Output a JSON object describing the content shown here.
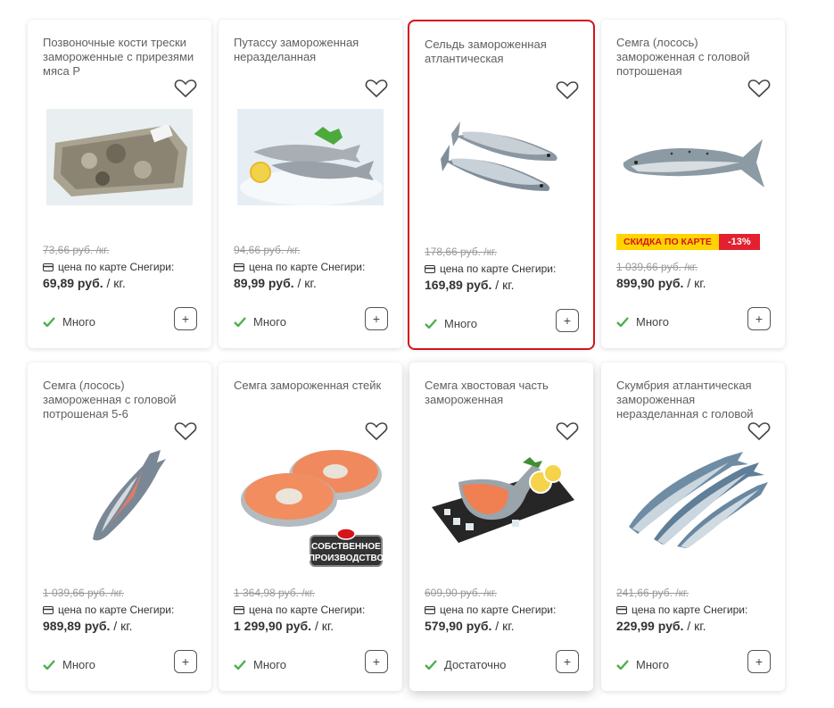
{
  "labels": {
    "card_price_label": "цена по карте Снегири:",
    "unit": "/ кг.",
    "discount_badge": "СКИДКА ПО КАРТЕ",
    "own_production": [
      "СОБСТВЕННОЕ",
      "ПРОИЗВОДСТВО"
    ]
  },
  "colors": {
    "accent_red": "#d4131b",
    "check_green": "#4caf50",
    "badge_yellow": "#ffd400"
  },
  "products": [
    {
      "title": "Позвоночные кости трески замороженные с прирезями мяса Р",
      "old_price": "73,66 руб. /кг.",
      "price": "69,89 руб.",
      "stock": "Много",
      "image": "cod-bones"
    },
    {
      "title": "Путассу замороженная неразделанная",
      "old_price": "94,66 руб. /кг.",
      "price": "89,99 руб.",
      "stock": "Много",
      "image": "blue-whiting"
    },
    {
      "title": "Сельдь замороженная атлантическая",
      "old_price": "178,66 руб. /кг.",
      "price": "169,89 руб.",
      "stock": "Много",
      "image": "herring",
      "selected": true
    },
    {
      "title": "Семга (лосось) замороженная с головой потрошеная",
      "old_price": "1 039,66 руб. /кг.",
      "price": "899,90 руб.",
      "stock": "Много",
      "image": "salmon",
      "discount": "-13%"
    },
    {
      "title": "Семга (лосось) замороженная с головой потрошеная 5-6",
      "old_price": "1 039,66 руб. /кг.",
      "price": "989,89 руб.",
      "stock": "Много",
      "image": "salmon-hanging"
    },
    {
      "title": "Семга замороженная стейк",
      "old_price": "1 364,98 руб. /кг.",
      "price": "1 299,90 руб.",
      "stock": "Много",
      "image": "salmon-steak"
    },
    {
      "title": "Семга хвостовая часть замороженная",
      "old_price": "609,90 руб. /кг.",
      "price": "579,90 руб.",
      "stock": "Достаточно",
      "image": "salmon-tail"
    },
    {
      "title": "Скумбрия атлантическая замороженная неразделанная с головой",
      "old_price": "241,66 руб. /кг.",
      "price": "229,99 руб.",
      "stock": "Много",
      "image": "mackerel"
    }
  ]
}
